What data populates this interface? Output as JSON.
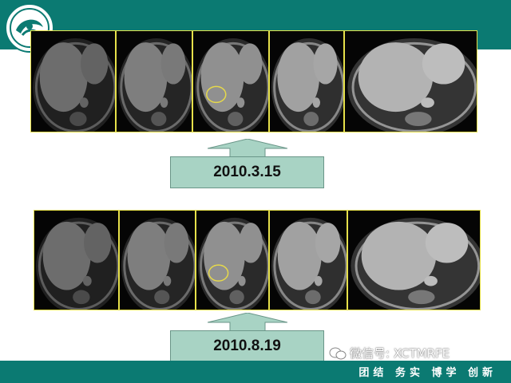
{
  "slide": {
    "motto": "团结 务实 博学 创新",
    "watermark": "微信号: XCTMRFE",
    "colors": {
      "header": "#0b7a72",
      "date_box": "#a8d3c4",
      "frame_border": "#e6e04a"
    }
  },
  "series": [
    {
      "date": "2010.3.15",
      "panel_count": 5,
      "lesion_circle_panel": 3
    },
    {
      "date": "2010.8.19",
      "panel_count": 5,
      "lesion_circle_panel": 3
    }
  ],
  "icons": {
    "logo": "hospital-logo-icon",
    "watermark": "wechat-icon",
    "arrow": "up-arrow-icon"
  }
}
